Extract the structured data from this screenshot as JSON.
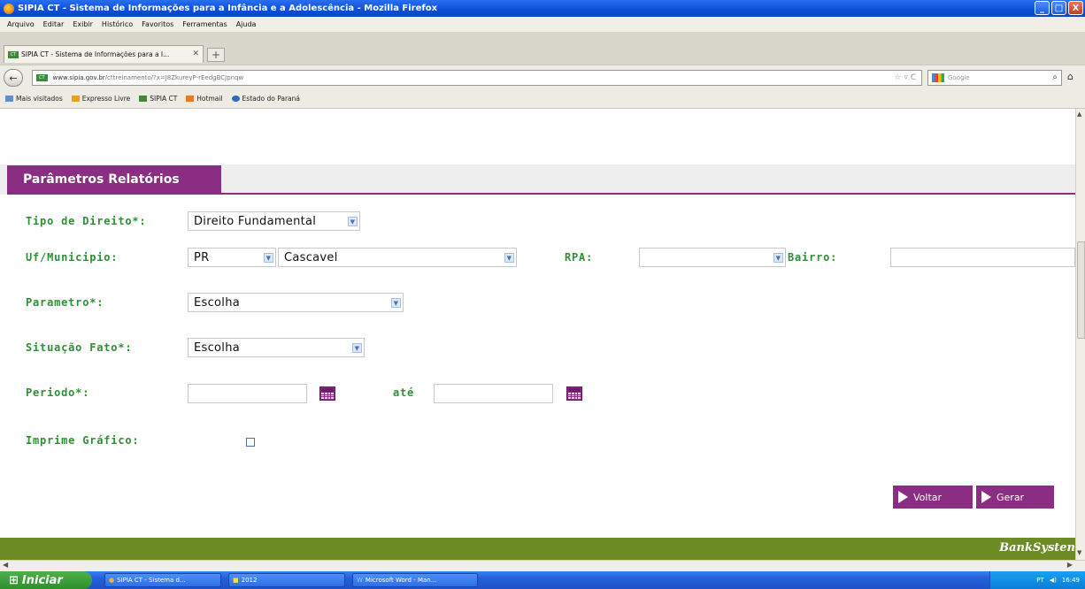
{
  "window": {
    "title": "SIPIA CT - Sistema de Informações para a Infância e a Adolescência - Mozilla Firefox",
    "buttons": [
      "_",
      "□",
      "X"
    ]
  },
  "menu": [
    "Arquivo",
    "Editar",
    "Exibir",
    "Histórico",
    "Favoritos",
    "Ferramentas",
    "Ajuda"
  ],
  "tab": {
    "label": "SIPIA CT - Sistema de Informações para a I...",
    "favicon": "CT"
  },
  "address": {
    "site_badge": "CT",
    "url_domain": "www.sipia.gov.br",
    "url_rest": "/cttreinamento/?x=J8ZkureyP-rEedgBCJpnqw",
    "search_placeholder": "Google"
  },
  "bookmarks": [
    "Mais visitados",
    "Expresso Livre",
    "SIPIA CT",
    "Hotmail",
    "Estado do Paraná"
  ],
  "page": {
    "section_title": "Parâmetros Relatórios",
    "fields": {
      "tipo_direito_label": "Tipo de Direito*:",
      "tipo_direito_value": "Direito Fundamental",
      "uf_municipio_label": "Uf/Municipio:",
      "uf_value": "PR",
      "municipio_value": "Cascavel",
      "rpa_label": "RPA:",
      "rpa_value": "",
      "bairro_label": "Bairro:",
      "parametro_label": "Parametro*:",
      "parametro_value": "Escolha",
      "situacao_label": "Situação Fato*:",
      "situacao_value": "Escolha",
      "periodo_label": "Periodo*:",
      "ate_label": "até",
      "imprime_label": "Imprime Gráfico:"
    },
    "buttons": {
      "voltar": "Voltar",
      "gerar": "Gerar"
    },
    "footer_brand": "BankSysten",
    "accent_color": "#8b2d82",
    "label_color": "#2f8f34",
    "footer_color": "#6e8c24"
  },
  "taskbar": {
    "start": "Iniciar",
    "items": [
      "SIPIA CT - Sistema d...",
      "2012",
      "Microsoft Word - Man..."
    ],
    "tray_lang": "PT",
    "tray_time": "16:49"
  }
}
